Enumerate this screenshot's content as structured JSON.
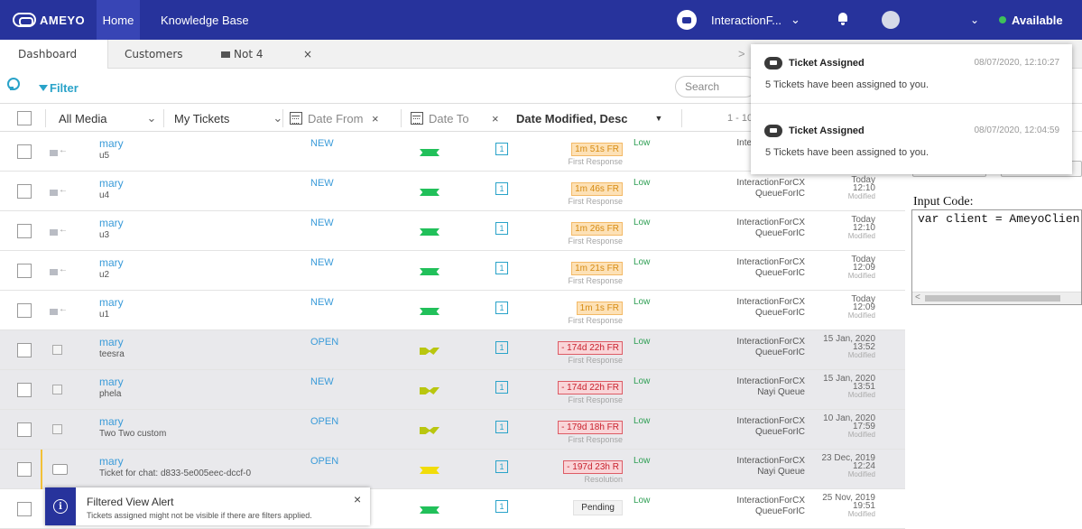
{
  "topbar": {
    "brand": "AMEYO",
    "nav_home": "Home",
    "nav_kb": "Knowledge Base",
    "interaction": "InteractionF...",
    "status": "Available",
    "colors": {
      "bar": "#27339c",
      "status_dot": "#3ec15a"
    }
  },
  "tabs": {
    "prev": "<",
    "items": [
      {
        "label": "Dashboard"
      },
      {
        "label": "Customers"
      },
      {
        "label": "Not 4"
      }
    ],
    "close": "×",
    "next": ">"
  },
  "filter": {
    "label": "Filter",
    "search_placeholder": "Search"
  },
  "header": {
    "media": "All Media",
    "view": "My Tickets",
    "date_from": "Date From",
    "date_to": "Date To",
    "clear": "×",
    "sort": "Date Modified, Desc",
    "range": "1 - 10"
  },
  "rows": [
    {
      "media": "email",
      "name": "mary",
      "sub": "u5",
      "state": "NEW",
      "flag": "green",
      "count": "1",
      "sla": "1m 51s FR",
      "sla_type": "amber",
      "sla_sub": "First Response",
      "priority": "Low",
      "queue1": "InteractionForCX",
      "queue2": "QueueForIC",
      "date1": "Today",
      "date2": "12:10",
      "mod": "Modified",
      "gray": false
    },
    {
      "media": "email",
      "name": "mary",
      "sub": "u4",
      "state": "NEW",
      "flag": "green",
      "count": "1",
      "sla": "1m 46s FR",
      "sla_type": "amber",
      "sla_sub": "First Response",
      "priority": "Low",
      "queue1": "InteractionForCX",
      "queue2": "QueueForIC",
      "date1": "Today",
      "date2": "12:10",
      "mod": "Modified",
      "gray": false
    },
    {
      "media": "email",
      "name": "mary",
      "sub": "u3",
      "state": "NEW",
      "flag": "green",
      "count": "1",
      "sla": "1m 26s FR",
      "sla_type": "amber",
      "sla_sub": "First Response",
      "priority": "Low",
      "queue1": "InteractionForCX",
      "queue2": "QueueForIC",
      "date1": "Today",
      "date2": "12:10",
      "mod": "Modified",
      "gray": false
    },
    {
      "media": "email",
      "name": "mary",
      "sub": "u2",
      "state": "NEW",
      "flag": "green",
      "count": "1",
      "sla": "1m 21s FR",
      "sla_type": "amber",
      "sla_sub": "First Response",
      "priority": "Low",
      "queue1": "InteractionForCX",
      "queue2": "QueueForIC",
      "date1": "Today",
      "date2": "12:09",
      "mod": "Modified",
      "gray": false
    },
    {
      "media": "email",
      "name": "mary",
      "sub": "u1",
      "state": "NEW",
      "flag": "green",
      "count": "1",
      "sla": "1m 1s FR",
      "sla_type": "amber",
      "sla_sub": "First Response",
      "priority": "Low",
      "queue1": "InteractionForCX",
      "queue2": "QueueForIC",
      "date1": "Today",
      "date2": "12:09",
      "mod": "Modified",
      "gray": false
    },
    {
      "media": "edit",
      "name": "mary",
      "sub": "teesra",
      "state": "OPEN",
      "flag": "olive",
      "count": "1",
      "sla": "- 174d 22h FR",
      "sla_type": "red",
      "sla_sub": "First Response",
      "priority": "Low",
      "queue1": "InteractionForCX",
      "queue2": "QueueForIC",
      "date1": "15 Jan, 2020",
      "date2": "13:52",
      "mod": "Modified",
      "gray": true
    },
    {
      "media": "edit",
      "name": "mary",
      "sub": "phela",
      "state": "NEW",
      "flag": "olive",
      "count": "1",
      "sla": "- 174d 22h FR",
      "sla_type": "red",
      "sla_sub": "First Response",
      "priority": "Low",
      "queue1": "InteractionForCX",
      "queue2": "Nayi Queue",
      "date1": "15 Jan, 2020",
      "date2": "13:51",
      "mod": "Modified",
      "gray": true
    },
    {
      "media": "edit",
      "name": "mary",
      "sub": "Two Two custom",
      "state": "OPEN",
      "flag": "olive",
      "count": "1",
      "sla": "- 179d 18h FR",
      "sla_type": "red",
      "sla_sub": "First Response",
      "priority": "Low",
      "queue1": "InteractionForCX",
      "queue2": "QueueForIC",
      "date1": "10 Jan, 2020",
      "date2": "17:59",
      "mod": "Modified",
      "gray": true
    },
    {
      "media": "chat",
      "name": "mary",
      "sub": "Ticket for chat: d833-5e005eec-dccf-0",
      "state": "OPEN",
      "flag": "yellow",
      "count": "1",
      "sla": "- 197d 23h R",
      "sla_type": "red",
      "sla_sub": "Resolution",
      "priority": "Low",
      "queue1": "InteractionForCX",
      "queue2": "Nayi Queue",
      "date1": "23 Dec, 2019",
      "date2": "12:24",
      "mod": "Modified",
      "gray": true
    },
    {
      "media": "chat",
      "name": "",
      "sub": "",
      "state": "",
      "flag": "green",
      "count": "1",
      "sla": "Pending",
      "sla_type": "pend",
      "sla_sub": "",
      "priority": "Low",
      "queue1": "InteractionForCX",
      "queue2": "QueueForIC",
      "date1": "25 Nov, 2019",
      "date2": "19:51",
      "mod": "Modified",
      "gray": false
    }
  ],
  "right_panel": {
    "input_code_label": "Input Code:",
    "code": "var client = AmeyoClien",
    "scroll_left": "<"
  },
  "notifications": [
    {
      "title": "Ticket Assigned",
      "time": "08/07/2020, 12:10:27",
      "body": "5 Tickets have been assigned to you."
    },
    {
      "title": "Ticket Assigned",
      "time": "08/07/2020, 12:04:59",
      "body": "5 Tickets have been assigned to you."
    }
  ],
  "alert": {
    "icon": "i",
    "title": "Filtered View Alert",
    "body": "Tickets assigned might not be visible if there are filters applied.",
    "close": "×"
  }
}
